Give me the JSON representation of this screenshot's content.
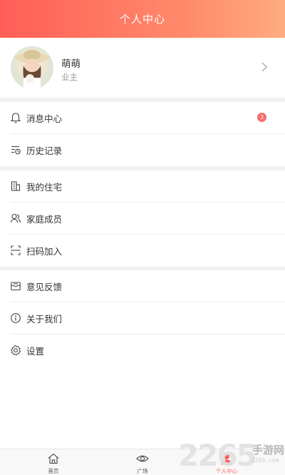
{
  "header": {
    "title": "个人中心"
  },
  "profile": {
    "name": "萌萌",
    "role": "业主"
  },
  "menu": {
    "group1": [
      {
        "label": "消息中心",
        "icon": "bell-icon",
        "badge": "3"
      },
      {
        "label": "历史记录",
        "icon": "history-list-icon"
      }
    ],
    "group2": [
      {
        "label": "我的住宅",
        "icon": "building-icon"
      },
      {
        "label": "家庭成员",
        "icon": "people-icon"
      },
      {
        "label": "扫码加入",
        "icon": "scan-icon"
      }
    ],
    "group3": [
      {
        "label": "意见反馈",
        "icon": "feedback-mail-icon"
      },
      {
        "label": "关于我们",
        "icon": "info-icon"
      },
      {
        "label": "设置",
        "icon": "gear-icon"
      }
    ]
  },
  "tabbar": {
    "tabs": [
      {
        "label": "首页",
        "icon": "home-icon"
      },
      {
        "label": "广场",
        "icon": "eye-icon"
      },
      {
        "label": "个人中心",
        "icon": "person-icon",
        "active": true
      }
    ]
  },
  "watermark": {
    "number": "2265",
    "text": "手游网",
    "url": "2265.com"
  },
  "colors": {
    "accent": "#ff5e57",
    "gradient_end": "#ffac82",
    "badge": "#f56d6d"
  }
}
